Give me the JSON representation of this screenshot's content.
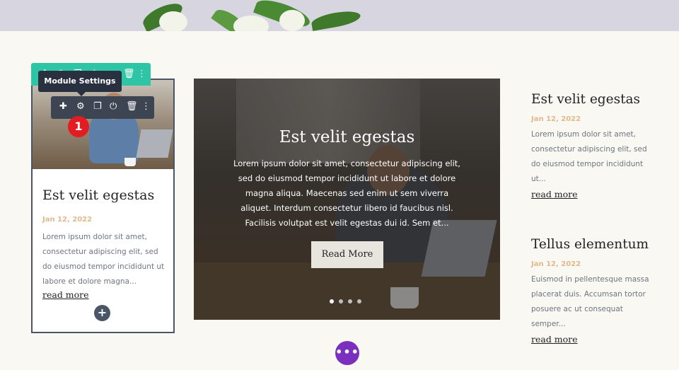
{
  "left_card": {
    "title": "Est velit egestas",
    "date": "Jan 12, 2022",
    "excerpt": "Lorem ipsum dolor sit amet, consectetur adipiscing elit, sed do eiusmod tempor incididunt ut labore et dolore magna...",
    "read_more": "read more",
    "add_label": "+"
  },
  "builder": {
    "tooltip": "Module Settings",
    "badge": "1",
    "section_toolbar_icons": [
      "move-icon",
      "gear-icon",
      "duplicate-icon",
      "power-icon",
      "trash-icon",
      "more-icon"
    ],
    "module_toolbar_icons": [
      "move-icon",
      "gear-icon",
      "duplicate-icon",
      "power-icon",
      "trash-icon",
      "more-icon"
    ],
    "fab_label": "•••",
    "accent_teal": "#2ec4a6",
    "accent_purple": "#7b2fbe",
    "badge_red": "#e31b23"
  },
  "slider": {
    "title": "Est velit egestas",
    "text": "Lorem ipsum dolor sit amet, consectetur adipiscing elit, sed do eiusmod tempor incididunt ut labore et dolore magna aliqua. Maecenas sed enim ut sem viverra aliquet. Interdum consectetur libero id faucibus nisl. Facilisis volutpat est velit egestas dui id. Sem et...",
    "button": "Read More",
    "dots": 4,
    "active_dot": 0
  },
  "posts": [
    {
      "title": "Est velit egestas",
      "date": "Jan 12, 2022",
      "excerpt": "Lorem ipsum dolor sit amet, consectetur adipiscing elit, sed do eiusmod tempor incididunt ut...",
      "read_more": "read more"
    },
    {
      "title": "Tellus elementum",
      "date": "Jan 12, 2022",
      "excerpt": "Euismod in pellentesque massa placerat duis. Accumsan tortor posuere ac ut consequat semper...",
      "read_more": "read more"
    }
  ]
}
